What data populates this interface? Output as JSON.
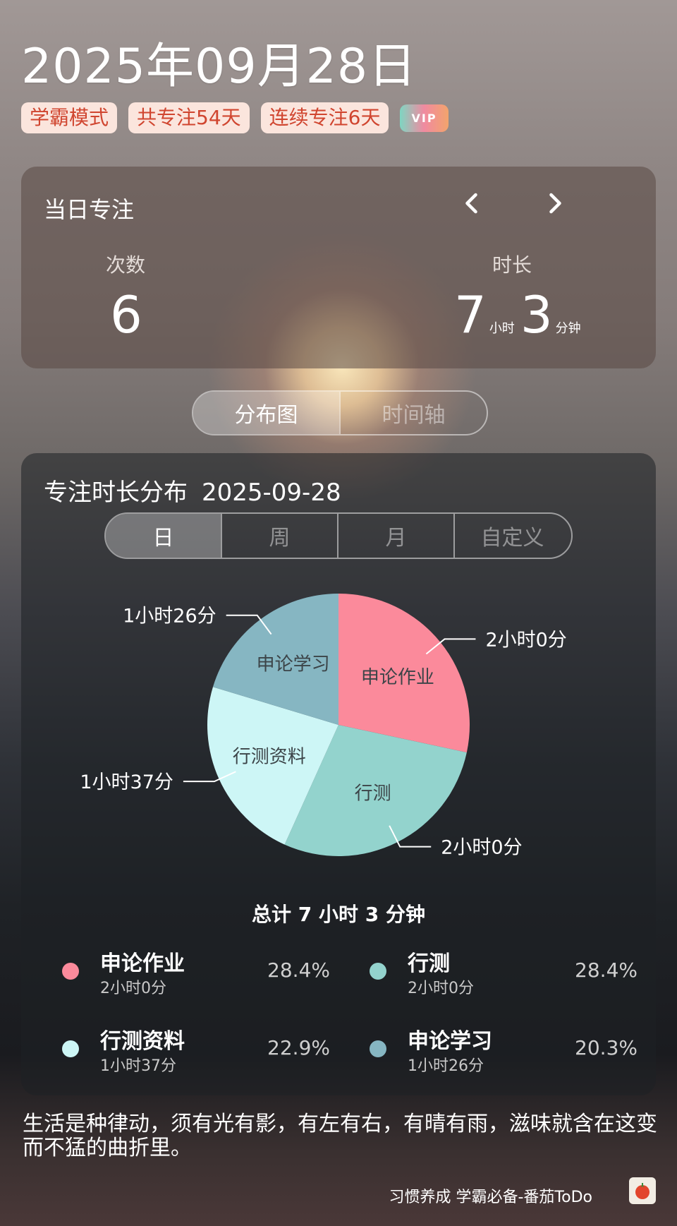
{
  "header": {
    "date_title": "2025年09月28日",
    "tags": [
      "学霸模式",
      "共专注54天",
      "连续专注6天"
    ],
    "vip_badge": "VIP"
  },
  "daily_focus": {
    "title": "当日专注",
    "count_label": "次数",
    "count_value": "6",
    "duration_label": "时长",
    "duration_hours": "7",
    "hours_unit": "小时",
    "duration_minutes": "3",
    "minutes_unit": "分钟"
  },
  "view_tabs": [
    {
      "label": "分布图",
      "active": true
    },
    {
      "label": "时间轴",
      "active": false
    }
  ],
  "distribution": {
    "title": "专注时长分布",
    "date": "2025-09-28",
    "range_tabs": [
      {
        "label": "日",
        "active": true
      },
      {
        "label": "周",
        "active": false
      },
      {
        "label": "月",
        "active": false
      },
      {
        "label": "自定义",
        "active": false
      }
    ],
    "total": "总计 7 小时 3 分钟",
    "legend": [
      {
        "name": "申论作业",
        "duration": "2小时0分",
        "percent": "28.4%",
        "color": "#fb8a9b"
      },
      {
        "name": "行测",
        "duration": "2小时0分",
        "percent": "28.4%",
        "color": "#93d3cd"
      },
      {
        "name": "行测资料",
        "duration": "1小时37分",
        "percent": "22.9%",
        "color": "#cdf6f6"
      },
      {
        "name": "申论学习",
        "duration": "1小时26分",
        "percent": "20.3%",
        "color": "#86b6c2"
      }
    ]
  },
  "chart_data": {
    "type": "pie",
    "categories": [
      "申论作业",
      "行测",
      "行测资料",
      "申论学习"
    ],
    "values": [
      120,
      120,
      97,
      86
    ],
    "value_labels": [
      "2小时0分",
      "2小时0分",
      "1小时37分",
      "1小时26分"
    ],
    "colors": [
      "#fb8a9b",
      "#93d3cd",
      "#cdf6f6",
      "#86b6c2"
    ]
  },
  "quote": "生活是种律动，须有光有影，有左有右，有晴有雨，滋味就含在这变而不猛的曲折里。",
  "footer": {
    "text": "习惯养成 学霸必备-番茄ToDo",
    "icon": "tomato-icon"
  }
}
